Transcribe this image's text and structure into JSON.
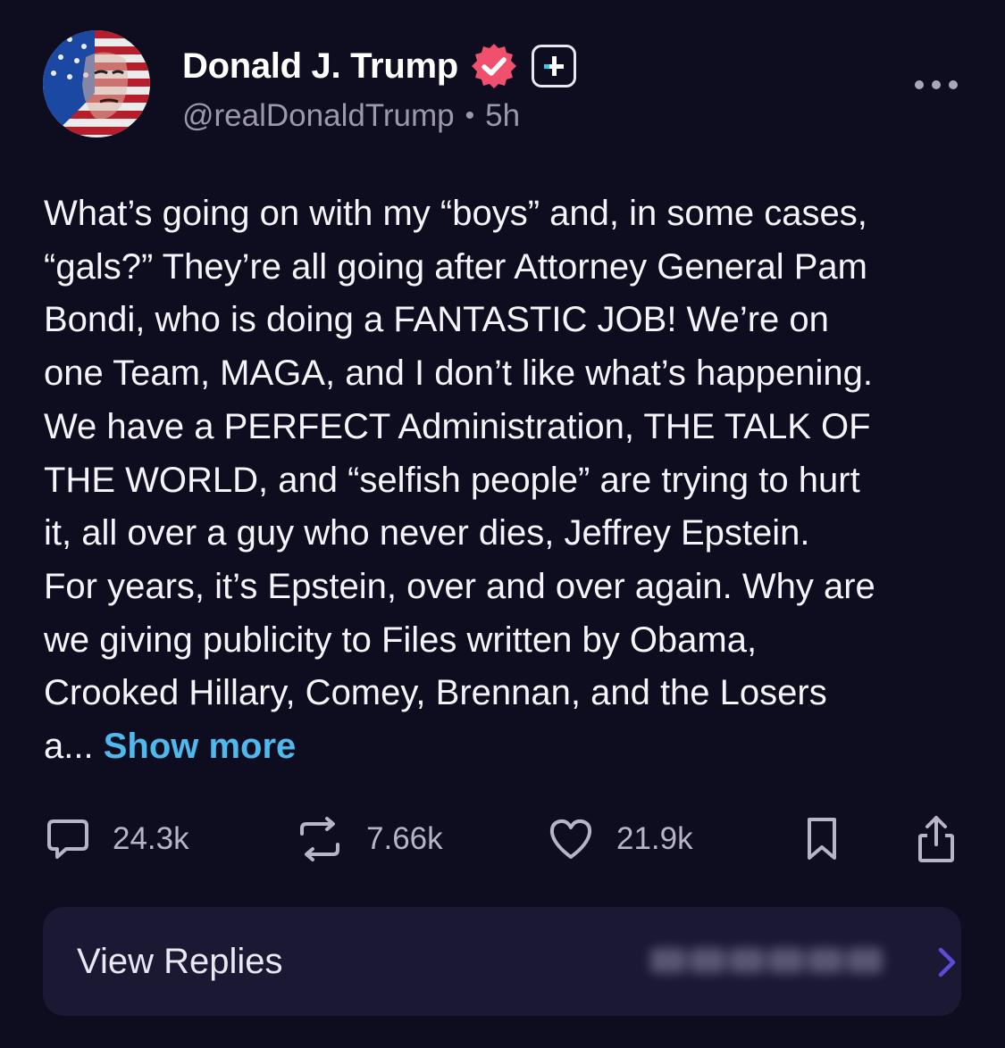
{
  "author": {
    "display_name": "Donald J. Trump",
    "handle": "@realDonaldTrump",
    "separator": "•",
    "time_ago": "5h",
    "verified_icon": "verified-badge-icon",
    "badge_icon": "plus-badge-icon"
  },
  "post": {
    "lines": [
      "What’s going on with my “boys” and, in some cases,",
      "“gals?” They’re all going after Attorney General Pam",
      "Bondi, who is doing a FANTASTIC JOB! We’re on",
      "one Team, MAGA, and I don’t like what’s happening.",
      "We have a PERFECT Administration, THE TALK OF",
      "THE WORLD, and “selfish people” are trying to hurt",
      "it, all over a guy who never dies, Jeffrey Epstein.",
      "For years, it’s Epstein, over and over again. Why are",
      "we giving publicity to Files written by Obama,",
      "Crooked Hillary, Comey, Brennan, and the Losers"
    ],
    "truncated_tail": "a...",
    "show_more_label": "Show more"
  },
  "actions": {
    "replies": {
      "count": "24.3k",
      "icon": "comment-icon"
    },
    "reposts": {
      "count": "7.66k",
      "icon": "repost-icon"
    },
    "likes": {
      "count": "21.9k",
      "icon": "heart-icon"
    },
    "bookmark": {
      "icon": "bookmark-icon"
    },
    "share": {
      "icon": "share-icon"
    }
  },
  "view_replies": {
    "label": "View Replies",
    "icon": "chevron-right-icon"
  },
  "colors": {
    "background": "#0e0c1f",
    "text": "#f5f4fa",
    "muted": "#9b98ad",
    "link": "#4fb8ec",
    "verified": "#f0506e",
    "card": "#1a1833",
    "chevron": "#5b4bd6"
  }
}
